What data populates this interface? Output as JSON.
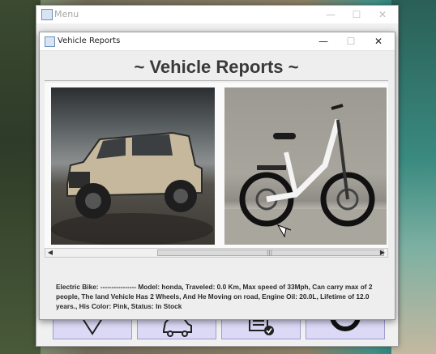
{
  "menu_window": {
    "title": "Menu",
    "controls": {
      "minimize": "—",
      "maximize": "☐",
      "close": "✕"
    },
    "buttons": [
      {
        "icon": "heart-icon"
      },
      {
        "icon": "car-icon"
      },
      {
        "icon": "document-check-icon"
      },
      {
        "icon": "ring-icon"
      }
    ]
  },
  "reports_window": {
    "title": "Vehicle Reports",
    "controls": {
      "minimize": "—",
      "maximize": "☐",
      "close": "✕"
    },
    "header": "~ Vehicle Reports ~",
    "images": [
      {
        "icon": "jeep-photo"
      },
      {
        "icon": "electric-bike-photo"
      }
    ],
    "scrollbar": {
      "left_arrow": "◀",
      "right_arrow": "▶",
      "grip": "|||"
    },
    "description": "Electric Bike: ---------------- Model: honda, Traveled: 0.0 Km, Max speed of 33Mph, Can carry max of 2 people, The land Vehicle Has 2 Wheels, And He Moving on road, Engine Oil: 20.0L, Lifetime of 12.0 years., His Color: Pink, Status: In Stock"
  },
  "colors": {
    "menu_button_bg": "#dcd9f6",
    "menu_button_border": "#9f9ccf",
    "header_text": "#3a3a3a"
  }
}
